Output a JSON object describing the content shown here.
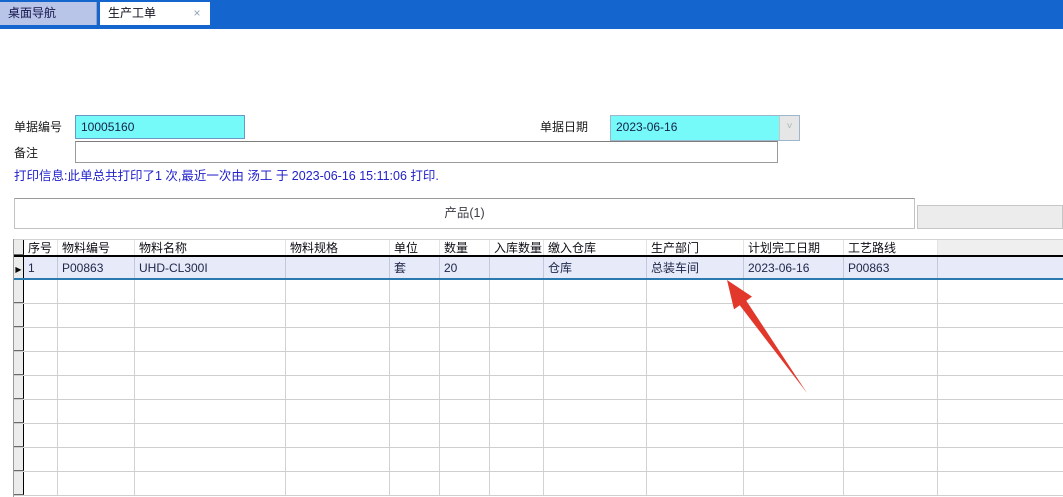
{
  "tabs": {
    "inactive_label": "桌面导航",
    "active_label": "生产工单",
    "close_glyph": "×"
  },
  "form": {
    "doc_no_label": "单据编号",
    "doc_no_value": "10005160",
    "doc_date_label": "单据日期",
    "doc_date_value": "2023-06-16",
    "date_drop_glyph": "˅",
    "remarks_label": "备注",
    "remarks_value": "",
    "print_info": "打印信息:此单总共打印了1 次,最近一次由 汤工 于 2023-06-16 15:11:06  打印."
  },
  "product_section": {
    "title": "产品(1)"
  },
  "table": {
    "columns": [
      "序号",
      "物料编号",
      "物料名称",
      "物料规格",
      "单位",
      "数量",
      "入库数量",
      "缴入仓库",
      "生产部门",
      "计划完工日期",
      "工艺路线",
      ""
    ],
    "rows": [
      [
        "1",
        "P00863",
        "UHD-CL300I",
        "",
        "套",
        "20",
        "",
        "仓库",
        "总装车间",
        "2023-06-16",
        "P00863",
        ""
      ]
    ],
    "selected_row_index": 0,
    "row_marker_glyph": "▶",
    "empty_row_count": 9
  },
  "colors": {
    "tabbar_blue": "#1565cf",
    "inactive_tab": "#b9c5e8",
    "field_cyan": "#76f9f9",
    "print_text_blue": "#2121cd",
    "selected_row_bg": "#e7eaf9",
    "selected_row_border": "#2a7ab0",
    "annotation_arrow_red": "#e2372b"
  }
}
